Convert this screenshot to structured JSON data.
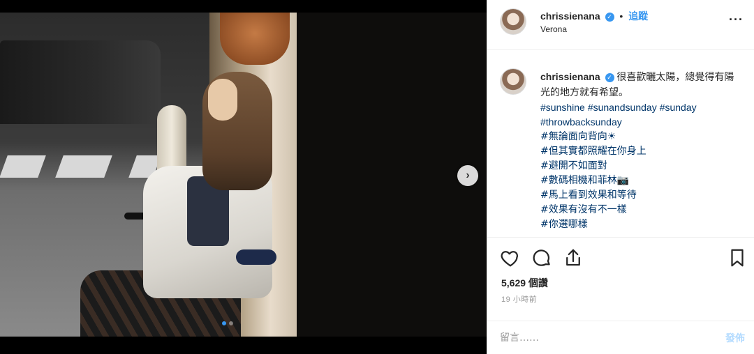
{
  "post": {
    "username": "chrissienana",
    "follow_label": "追蹤",
    "separator": "•",
    "location": "Verona",
    "more_label": "···",
    "verified_glyph": "✓"
  },
  "caption": {
    "username": "chrissienana",
    "lead": "很喜歡曬太陽，總覺得有陽光的地方就有希望。",
    "inline_tags": [
      "#sunshine",
      "#sunandsunday",
      "#sunday"
    ],
    "tags": [
      "#throwbacksunday",
      "#無論面向背向☀",
      "#但其實都照耀在你身上",
      "#避開不如面對",
      "#數碼相機和菲林📷",
      "#馬上看到效果和等待",
      "#效果有沒有不一樣",
      "#你選哪樣"
    ]
  },
  "actions": {
    "views": "5,629 個讚",
    "time": "19 小時前"
  },
  "comment": {
    "placeholder": "留言……",
    "post_label": "發佈"
  },
  "carousel": {
    "next_glyph": "›",
    "dot_count": 2,
    "active_index": 0
  },
  "colors": {
    "accent": "#3897f0",
    "hashtag": "#003569",
    "muted": "#999999",
    "post_disabled": "#b3dbff"
  },
  "icons": [
    "heart-icon",
    "comment-icon",
    "share-icon",
    "bookmark-icon",
    "chevron-right-icon",
    "verified-icon",
    "more-icon"
  ]
}
